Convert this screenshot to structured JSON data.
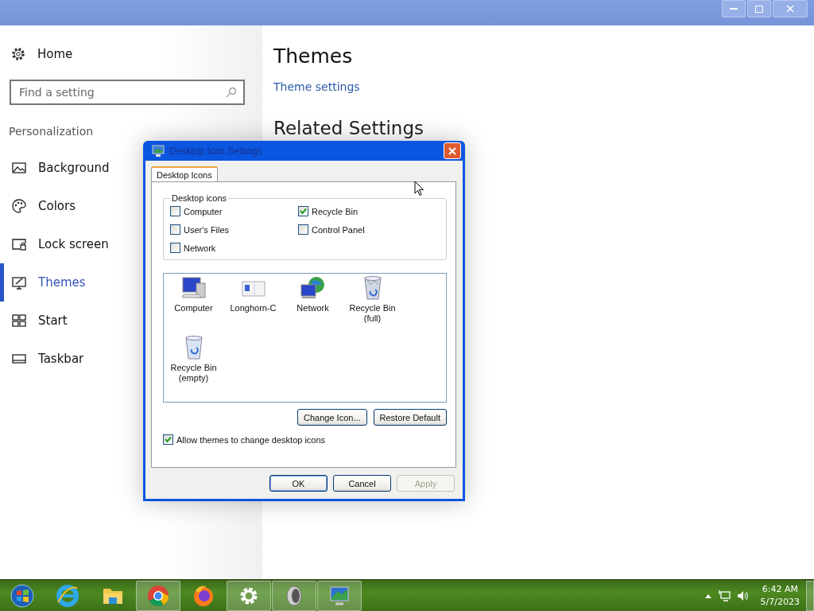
{
  "sidebar": {
    "home": "Home",
    "search": {
      "placeholder": "Find a setting"
    },
    "section": "Personalization",
    "items": [
      {
        "label": "Background",
        "selected": false
      },
      {
        "label": "Colors",
        "selected": false
      },
      {
        "label": "Lock screen",
        "selected": false
      },
      {
        "label": "Themes",
        "selected": true
      },
      {
        "label": "Start",
        "selected": false
      },
      {
        "label": "Taskbar",
        "selected": false
      }
    ]
  },
  "content": {
    "title": "Themes",
    "link": "Theme settings",
    "related_heading": "Related Settings"
  },
  "dialog": {
    "title": "Desktop Icon Settings",
    "tabs": [
      {
        "label": "Desktop Icons",
        "selected": true
      }
    ],
    "group_title": "Desktop icons",
    "checkboxes": [
      {
        "label": "Computer",
        "checked": false
      },
      {
        "label": "Recycle Bin",
        "checked": true
      },
      {
        "label": "User's Files",
        "checked": false
      },
      {
        "label": "Control Panel",
        "checked": false
      },
      {
        "label": "Network",
        "checked": false
      }
    ],
    "icons": [
      {
        "label": "Computer",
        "kind": "computer"
      },
      {
        "label": "Longhorn-C",
        "kind": "folder"
      },
      {
        "label": "Network",
        "kind": "network"
      },
      {
        "label": "Recycle Bin\n(full)",
        "kind": "bin-full"
      },
      {
        "label": "Recycle Bin\n(empty)",
        "kind": "bin-empty"
      }
    ],
    "change_icon": "Change Icon...",
    "restore_default": "Restore Default",
    "allow_themes": {
      "label": "Allow themes to change desktop icons",
      "checked": true
    },
    "buttons": [
      {
        "label": "OK",
        "disabled": false
      },
      {
        "label": "Cancel",
        "disabled": false
      },
      {
        "label": "Apply",
        "disabled": true
      }
    ]
  },
  "taskbar": {
    "apps": [
      {
        "highlighted": false
      },
      {
        "highlighted": false
      },
      {
        "highlighted": false
      },
      {
        "highlighted": true
      },
      {
        "highlighted": false
      },
      {
        "highlighted": true
      },
      {
        "highlighted": true
      },
      {
        "highlighted": true
      }
    ],
    "time": "6:42 AM",
    "date": "5/7/2023"
  }
}
